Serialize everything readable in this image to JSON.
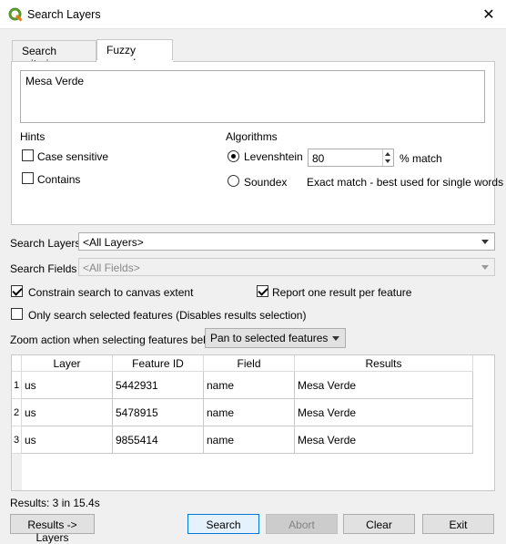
{
  "window": {
    "title": "Search Layers",
    "close_glyph": "✕"
  },
  "tabs": [
    {
      "label": "Search criteria",
      "active": false
    },
    {
      "label": "Fuzzy search",
      "active": true
    }
  ],
  "search_text": "Mesa Verde",
  "hints": {
    "title": "Hints",
    "case_sensitive": {
      "label": "Case sensitive",
      "checked": false
    },
    "contains": {
      "label": "Contains",
      "checked": false
    }
  },
  "algorithms": {
    "title": "Algorithms",
    "levenshtein": {
      "label": "Levenshtein",
      "selected": true,
      "value": "80",
      "suffix": "% match"
    },
    "soundex": {
      "label": "Soundex",
      "selected": false,
      "note": "Exact match - best used for single words"
    }
  },
  "search_layers": {
    "label": "Search Layers",
    "value": "<All Layers>"
  },
  "search_fields": {
    "label": "Search Fields",
    "value": "<All Fields>"
  },
  "options": {
    "constrain": {
      "label": "Constrain search to canvas extent",
      "checked": true
    },
    "report_one": {
      "label": "Report one result per feature",
      "checked": true
    },
    "only_selected": {
      "label": "Only search selected features (Disables results selection)",
      "checked": false
    }
  },
  "zoom_action": {
    "label": "Zoom action when selecting features below",
    "value": "Pan to selected features"
  },
  "table": {
    "headers": [
      "Layer",
      "Feature ID",
      "Field",
      "Results"
    ],
    "rows": [
      {
        "num": "1",
        "layer": "us",
        "feature_id": "5442931",
        "field": "name",
        "result": "Mesa Verde"
      },
      {
        "num": "2",
        "layer": "us",
        "feature_id": "5478915",
        "field": "name",
        "result": "Mesa Verde"
      },
      {
        "num": "3",
        "layer": "us",
        "feature_id": "9855414",
        "field": "name",
        "result": "Mesa Verde"
      }
    ]
  },
  "status": "Results: 3 in 15.4s",
  "buttons": {
    "results_layers": "Results -> Layers",
    "search": "Search",
    "abort": "Abort",
    "clear": "Clear",
    "exit": "Exit"
  }
}
